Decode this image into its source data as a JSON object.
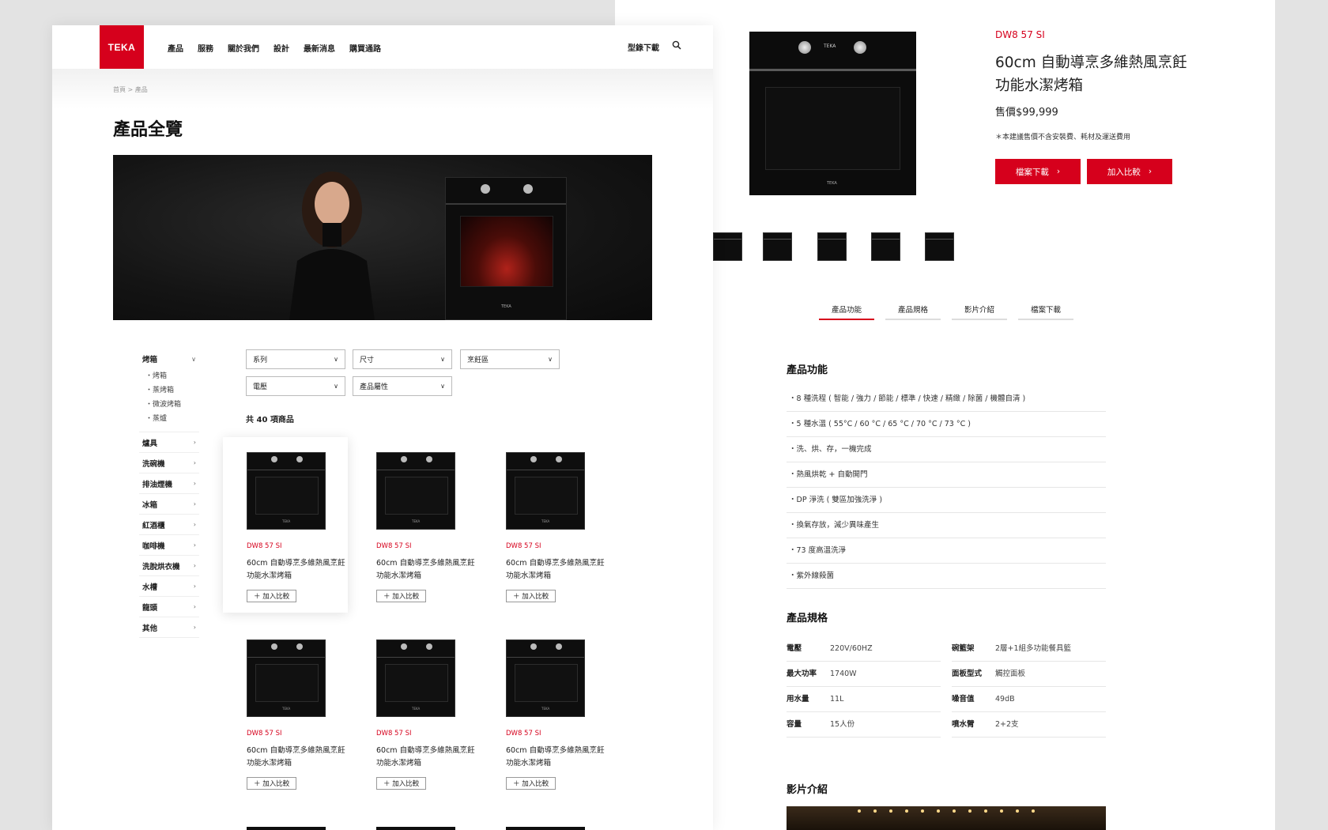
{
  "left": {
    "logo": "TEKA",
    "nav": [
      "產品",
      "服務",
      "關於我們",
      "設計",
      "最新消息",
      "購買通路"
    ],
    "catalog_link": "型錄下載",
    "breadcrumb": "首頁 > 產品",
    "page_title": "產品全覽",
    "hero_oven_logo": "TEKA",
    "sidebar": {
      "first": "烤箱",
      "subs": [
        "・烤箱",
        "・蒸烤箱",
        "・微波烤箱",
        "・蒸爐"
      ],
      "others": [
        "爐具",
        "洗碗機",
        "排油煙機",
        "冰箱",
        "紅酒櫃",
        "咖啡機",
        "洗脫烘衣機",
        "水槽",
        "龍頭",
        "其他"
      ]
    },
    "filters": [
      "系列",
      "尺寸",
      "烹飪區",
      "電壓",
      "產品屬性"
    ],
    "total": "共 40 項商品",
    "product": {
      "code": "DW8 57 SI",
      "name": "60cm 自動導烹多維熱風烹飪功能水潔烤箱",
      "compare": "＋ 加入比較",
      "logo": "TEKA"
    }
  },
  "right": {
    "code": "DW8 57 SI",
    "name": "60cm 自動導烹多維熱風烹飪功能水潔烤箱",
    "price": "售價$99,999",
    "note": "＊本建議售價不含安裝費、耗材及運送費用",
    "btn_download": "檔案下載",
    "btn_compare": "加入比較",
    "oven_screen": "TEKA",
    "oven_logo": "TEKA",
    "tabs": [
      "產品功能",
      "產品規格",
      "影片介紹",
      "檔案下載"
    ],
    "features_title": "產品功能",
    "features": [
      "・8 種洗程 ( 智能 / 強力 / 節能 / 標準 / 快速 / 精緻 / 除菌 / 機體自清 )",
      "・5 種水溫 ( 55°C / 60 °C / 65 °C / 70 °C / 73 °C )",
      "・洗、烘、存，一機完成",
      "・熱風烘乾 + 自動開門",
      "・DP 淨洗 ( 雙區加強洗淨 )",
      "・換氣存放，減少異味產生",
      "・73 度高溫洗淨",
      "・紫外線殺菌"
    ],
    "specs_title": "產品規格",
    "specs_left": [
      {
        "k": "電壓",
        "v": "220V/60HZ"
      },
      {
        "k": "最大功率",
        "v": "1740W"
      },
      {
        "k": "用水量",
        "v": "11L"
      },
      {
        "k": "容量",
        "v": "15人份"
      }
    ],
    "specs_right": [
      {
        "k": "碗籃架",
        "v": "2層+1組多功能餐具籃"
      },
      {
        "k": "面板型式",
        "v": "觸控面板"
      },
      {
        "k": "噪音值",
        "v": "49dB"
      },
      {
        "k": "噴水臂",
        "v": "2+2支"
      }
    ],
    "video_title": "影片介紹"
  },
  "colors": {
    "brand_red": "#d6001c"
  }
}
